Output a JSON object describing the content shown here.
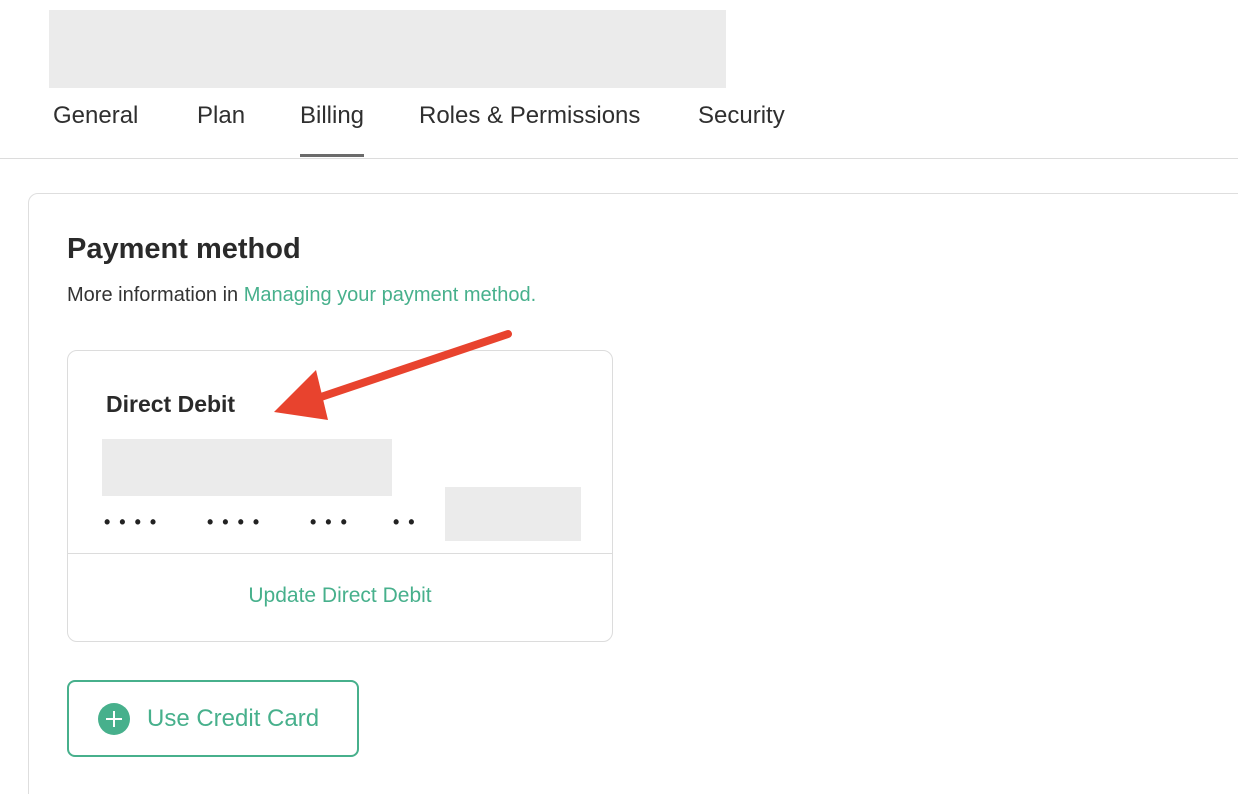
{
  "tabs": [
    {
      "label": "General"
    },
    {
      "label": "Plan"
    },
    {
      "label": "Billing",
      "active": true
    },
    {
      "label": "Roles & Permissions"
    },
    {
      "label": "Security"
    }
  ],
  "payment": {
    "heading": "Payment method",
    "info_prefix": "More information in ",
    "info_link": "Managing your payment method."
  },
  "direct_debit": {
    "title": "Direct Debit",
    "masked_groups": [
      "••••",
      "••••",
      "•••",
      "••"
    ],
    "update_label": "Update Direct Debit"
  },
  "credit_card_button": {
    "label": "Use Credit Card",
    "icon": "plus-circle-icon"
  },
  "colors": {
    "accent": "#47b08c",
    "annotation_arrow": "#e8432e",
    "redaction": "#ebebeb"
  }
}
